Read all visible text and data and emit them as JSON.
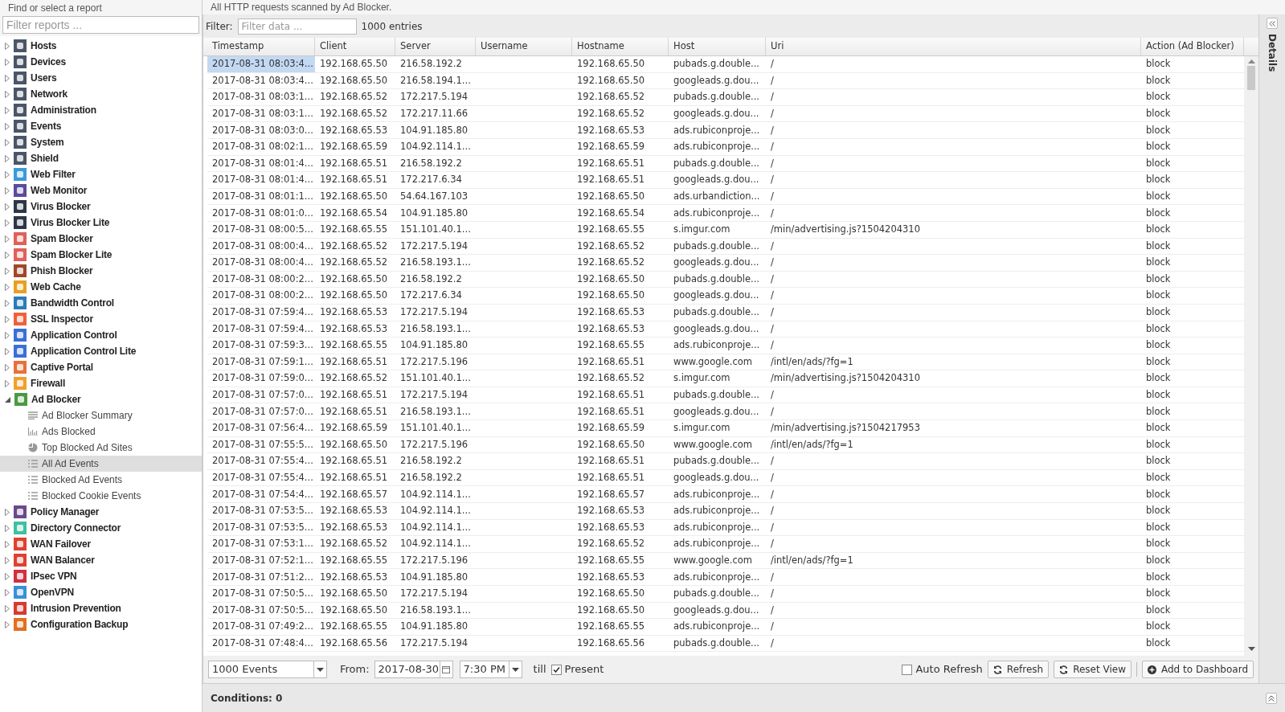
{
  "sidebar": {
    "title": "Find or select a report",
    "filter": {
      "placeholder": "Filter reports ..."
    },
    "items": [
      {
        "label": "Hosts",
        "color": "#4a5568",
        "expanded": false
      },
      {
        "label": "Devices",
        "color": "#4a5568",
        "expanded": false
      },
      {
        "label": "Users",
        "color": "#4a5568",
        "expanded": false
      },
      {
        "label": "Network",
        "color": "#4a5568",
        "expanded": false
      },
      {
        "label": "Administration",
        "color": "#4a5568",
        "expanded": false
      },
      {
        "label": "Events",
        "color": "#4a5568",
        "expanded": false
      },
      {
        "label": "System",
        "color": "#4a5568",
        "expanded": false
      },
      {
        "label": "Shield",
        "color": "#4a5568",
        "expanded": false
      },
      {
        "label": "Web Filter",
        "color": "#3b9ad9",
        "expanded": false
      },
      {
        "label": "Web Monitor",
        "color": "#5b4a9e",
        "expanded": false
      },
      {
        "label": "Virus Blocker",
        "color": "#2d3748",
        "expanded": false
      },
      {
        "label": "Virus Blocker Lite",
        "color": "#2d3748",
        "expanded": false
      },
      {
        "label": "Spam Blocker",
        "color": "#e0605a",
        "expanded": false
      },
      {
        "label": "Spam Blocker Lite",
        "color": "#e0605a",
        "expanded": false
      },
      {
        "label": "Phish Blocker",
        "color": "#a0482a",
        "expanded": false
      },
      {
        "label": "Web Cache",
        "color": "#e8a020",
        "expanded": false
      },
      {
        "label": "Bandwidth Control",
        "color": "#2b7bb9",
        "expanded": false
      },
      {
        "label": "SSL Inspector",
        "color": "#f0603a",
        "expanded": false
      },
      {
        "label": "Application Control",
        "color": "#3a6fd8",
        "expanded": false
      },
      {
        "label": "Application Control Lite",
        "color": "#3a6fd8",
        "expanded": false
      },
      {
        "label": "Captive Portal",
        "color": "#e8703a",
        "expanded": false
      },
      {
        "label": "Firewall",
        "color": "#f0a030",
        "expanded": false
      },
      {
        "label": "Ad Blocker",
        "color": "#4a9a40",
        "expanded": true,
        "children": [
          {
            "label": "Ad Blocker Summary",
            "kind": "text",
            "selected": false
          },
          {
            "label": "Ads Blocked",
            "kind": "bars",
            "selected": false
          },
          {
            "label": "Top Blocked Ad Sites",
            "kind": "pie",
            "selected": false
          },
          {
            "label": "All Ad Events",
            "kind": "list",
            "selected": true
          },
          {
            "label": "Blocked Ad Events",
            "kind": "list",
            "selected": false
          },
          {
            "label": "Blocked Cookie Events",
            "kind": "list",
            "selected": false
          }
        ]
      },
      {
        "label": "Policy Manager",
        "color": "#6a4a8a",
        "expanded": false
      },
      {
        "label": "Directory Connector",
        "color": "#40c0a0",
        "expanded": false
      },
      {
        "label": "WAN Failover",
        "color": "#e04030",
        "expanded": false
      },
      {
        "label": "WAN Balancer",
        "color": "#e04030",
        "expanded": false
      },
      {
        "label": "IPsec VPN",
        "color": "#d03040",
        "expanded": false
      },
      {
        "label": "OpenVPN",
        "color": "#3a90d8",
        "expanded": false
      },
      {
        "label": "Intrusion Prevention",
        "color": "#d83a30",
        "expanded": false
      },
      {
        "label": "Configuration Backup",
        "color": "#e07020",
        "expanded": false
      }
    ]
  },
  "report": {
    "description": "All HTTP requests scanned by Ad Blocker.",
    "filter_label": "Filter:",
    "filter": {
      "placeholder": "Filter data ..."
    },
    "entries": "1000 entries"
  },
  "table": {
    "columns": [
      "Timestamp",
      "Client",
      "Server",
      "Username",
      "Hostname",
      "Host",
      "Uri",
      "Action (Ad Blocker)"
    ],
    "rows": [
      {
        "timestamp": "2017-08-31 08:03:4...",
        "client": "192.168.65.50",
        "server": "216.58.192.2",
        "hostname": "192.168.65.50",
        "host": "pubads.g.double...",
        "uri": "/",
        "action": "block",
        "selected": true
      },
      {
        "timestamp": "2017-08-31 08:03:4...",
        "client": "192.168.65.50",
        "server": "216.58.194.1...",
        "hostname": "192.168.65.50",
        "host": "googleads.g.dou...",
        "uri": "/",
        "action": "block",
        "selected": false
      },
      {
        "timestamp": "2017-08-31 08:03:1...",
        "client": "192.168.65.52",
        "server": "172.217.5.194",
        "hostname": "192.168.65.52",
        "host": "pubads.g.double...",
        "uri": "/",
        "action": "block",
        "selected": false
      },
      {
        "timestamp": "2017-08-31 08:03:1...",
        "client": "192.168.65.52",
        "server": "172.217.11.66",
        "hostname": "192.168.65.52",
        "host": "googleads.g.dou...",
        "uri": "/",
        "action": "block",
        "selected": false
      },
      {
        "timestamp": "2017-08-31 08:03:0...",
        "client": "192.168.65.53",
        "server": "104.91.185.80",
        "hostname": "192.168.65.53",
        "host": "ads.rubiconproje...",
        "uri": "/",
        "action": "block",
        "selected": false
      },
      {
        "timestamp": "2017-08-31 08:02:1...",
        "client": "192.168.65.59",
        "server": "104.92.114.1...",
        "hostname": "192.168.65.59",
        "host": "ads.rubiconproje...",
        "uri": "/",
        "action": "block",
        "selected": false
      },
      {
        "timestamp": "2017-08-31 08:01:4...",
        "client": "192.168.65.51",
        "server": "216.58.192.2",
        "hostname": "192.168.65.51",
        "host": "pubads.g.double...",
        "uri": "/",
        "action": "block",
        "selected": false
      },
      {
        "timestamp": "2017-08-31 08:01:4...",
        "client": "192.168.65.51",
        "server": "172.217.6.34",
        "hostname": "192.168.65.51",
        "host": "googleads.g.dou...",
        "uri": "/",
        "action": "block",
        "selected": false
      },
      {
        "timestamp": "2017-08-31 08:01:1...",
        "client": "192.168.65.50",
        "server": "54.64.167.103",
        "hostname": "192.168.65.50",
        "host": "ads.urbandiction...",
        "uri": "/",
        "action": "block",
        "selected": false
      },
      {
        "timestamp": "2017-08-31 08:01:0...",
        "client": "192.168.65.54",
        "server": "104.91.185.80",
        "hostname": "192.168.65.54",
        "host": "ads.rubiconproje...",
        "uri": "/",
        "action": "block",
        "selected": false
      },
      {
        "timestamp": "2017-08-31 08:00:5...",
        "client": "192.168.65.55",
        "server": "151.101.40.1...",
        "hostname": "192.168.65.55",
        "host": "s.imgur.com",
        "uri": "/min/advertising.js?1504204310",
        "action": "block",
        "selected": false
      },
      {
        "timestamp": "2017-08-31 08:00:4...",
        "client": "192.168.65.52",
        "server": "172.217.5.194",
        "hostname": "192.168.65.52",
        "host": "pubads.g.double...",
        "uri": "/",
        "action": "block",
        "selected": false
      },
      {
        "timestamp": "2017-08-31 08:00:4...",
        "client": "192.168.65.52",
        "server": "216.58.193.1...",
        "hostname": "192.168.65.52",
        "host": "googleads.g.dou...",
        "uri": "/",
        "action": "block",
        "selected": false
      },
      {
        "timestamp": "2017-08-31 08:00:2...",
        "client": "192.168.65.50",
        "server": "216.58.192.2",
        "hostname": "192.168.65.50",
        "host": "pubads.g.double...",
        "uri": "/",
        "action": "block",
        "selected": false
      },
      {
        "timestamp": "2017-08-31 08:00:2...",
        "client": "192.168.65.50",
        "server": "172.217.6.34",
        "hostname": "192.168.65.50",
        "host": "googleads.g.dou...",
        "uri": "/",
        "action": "block",
        "selected": false
      },
      {
        "timestamp": "2017-08-31 07:59:4...",
        "client": "192.168.65.53",
        "server": "172.217.5.194",
        "hostname": "192.168.65.53",
        "host": "pubads.g.double...",
        "uri": "/",
        "action": "block",
        "selected": false
      },
      {
        "timestamp": "2017-08-31 07:59:4...",
        "client": "192.168.65.53",
        "server": "216.58.193.1...",
        "hostname": "192.168.65.53",
        "host": "googleads.g.dou...",
        "uri": "/",
        "action": "block",
        "selected": false
      },
      {
        "timestamp": "2017-08-31 07:59:3...",
        "client": "192.168.65.55",
        "server": "104.91.185.80",
        "hostname": "192.168.65.55",
        "host": "ads.rubiconproje...",
        "uri": "/",
        "action": "block",
        "selected": false
      },
      {
        "timestamp": "2017-08-31 07:59:1...",
        "client": "192.168.65.51",
        "server": "172.217.5.196",
        "hostname": "192.168.65.51",
        "host": "www.google.com",
        "uri": "/intl/en/ads/?fg=1",
        "action": "block",
        "selected": false
      },
      {
        "timestamp": "2017-08-31 07:59:0...",
        "client": "192.168.65.52",
        "server": "151.101.40.1...",
        "hostname": "192.168.65.52",
        "host": "s.imgur.com",
        "uri": "/min/advertising.js?1504204310",
        "action": "block",
        "selected": false
      },
      {
        "timestamp": "2017-08-31 07:57:0...",
        "client": "192.168.65.51",
        "server": "172.217.5.194",
        "hostname": "192.168.65.51",
        "host": "pubads.g.double...",
        "uri": "/",
        "action": "block",
        "selected": false
      },
      {
        "timestamp": "2017-08-31 07:57:0...",
        "client": "192.168.65.51",
        "server": "216.58.193.1...",
        "hostname": "192.168.65.51",
        "host": "googleads.g.dou...",
        "uri": "/",
        "action": "block",
        "selected": false
      },
      {
        "timestamp": "2017-08-31 07:56:4...",
        "client": "192.168.65.59",
        "server": "151.101.40.1...",
        "hostname": "192.168.65.59",
        "host": "s.imgur.com",
        "uri": "/min/advertising.js?1504217953",
        "action": "block",
        "selected": false
      },
      {
        "timestamp": "2017-08-31 07:55:5...",
        "client": "192.168.65.50",
        "server": "172.217.5.196",
        "hostname": "192.168.65.50",
        "host": "www.google.com",
        "uri": "/intl/en/ads/?fg=1",
        "action": "block",
        "selected": false
      },
      {
        "timestamp": "2017-08-31 07:55:4...",
        "client": "192.168.65.51",
        "server": "216.58.192.2",
        "hostname": "192.168.65.51",
        "host": "pubads.g.double...",
        "uri": "/",
        "action": "block",
        "selected": false
      },
      {
        "timestamp": "2017-08-31 07:55:4...",
        "client": "192.168.65.51",
        "server": "216.58.192.2",
        "hostname": "192.168.65.51",
        "host": "googleads.g.dou...",
        "uri": "/",
        "action": "block",
        "selected": false
      },
      {
        "timestamp": "2017-08-31 07:54:4...",
        "client": "192.168.65.57",
        "server": "104.92.114.1...",
        "hostname": "192.168.65.57",
        "host": "ads.rubiconproje...",
        "uri": "/",
        "action": "block",
        "selected": false
      },
      {
        "timestamp": "2017-08-31 07:53:5...",
        "client": "192.168.65.53",
        "server": "104.92.114.1...",
        "hostname": "192.168.65.53",
        "host": "ads.rubiconproje...",
        "uri": "/",
        "action": "block",
        "selected": false
      },
      {
        "timestamp": "2017-08-31 07:53:5...",
        "client": "192.168.65.53",
        "server": "104.92.114.1...",
        "hostname": "192.168.65.53",
        "host": "ads.rubiconproje...",
        "uri": "/",
        "action": "block",
        "selected": false
      },
      {
        "timestamp": "2017-08-31 07:53:1...",
        "client": "192.168.65.52",
        "server": "104.92.114.1...",
        "hostname": "192.168.65.52",
        "host": "ads.rubiconproje...",
        "uri": "/",
        "action": "block",
        "selected": false
      },
      {
        "timestamp": "2017-08-31 07:52:1...",
        "client": "192.168.65.55",
        "server": "172.217.5.196",
        "hostname": "192.168.65.55",
        "host": "www.google.com",
        "uri": "/intl/en/ads/?fg=1",
        "action": "block",
        "selected": false
      },
      {
        "timestamp": "2017-08-31 07:51:2...",
        "client": "192.168.65.53",
        "server": "104.91.185.80",
        "hostname": "192.168.65.53",
        "host": "ads.rubiconproje...",
        "uri": "/",
        "action": "block",
        "selected": false
      },
      {
        "timestamp": "2017-08-31 07:50:5...",
        "client": "192.168.65.50",
        "server": "172.217.5.194",
        "hostname": "192.168.65.50",
        "host": "pubads.g.double...",
        "uri": "/",
        "action": "block",
        "selected": false
      },
      {
        "timestamp": "2017-08-31 07:50:5...",
        "client": "192.168.65.50",
        "server": "216.58.193.1...",
        "hostname": "192.168.65.50",
        "host": "googleads.g.dou...",
        "uri": "/",
        "action": "block",
        "selected": false
      },
      {
        "timestamp": "2017-08-31 07:49:2...",
        "client": "192.168.65.55",
        "server": "104.91.185.80",
        "hostname": "192.168.65.55",
        "host": "ads.rubiconproje...",
        "uri": "/",
        "action": "block",
        "selected": false
      },
      {
        "timestamp": "2017-08-31 07:48:4...",
        "client": "192.168.65.56",
        "server": "172.217.5.194",
        "hostname": "192.168.65.56",
        "host": "pubads.g.double...",
        "uri": "/",
        "action": "block",
        "selected": false
      }
    ]
  },
  "toolbar": {
    "limit": "1000 Events",
    "from_label": "From:",
    "from_date": "2017-08-30",
    "from_time": "7:30 PM",
    "till_label": "till",
    "present": {
      "label": "Present",
      "checked": true
    },
    "auto_refresh": {
      "label": "Auto Refresh",
      "checked": false
    },
    "buttons": [
      "Refresh",
      "Reset View",
      "Add to Dashboard"
    ]
  },
  "conditions": "Conditions: 0",
  "details": {
    "title": "Details"
  }
}
